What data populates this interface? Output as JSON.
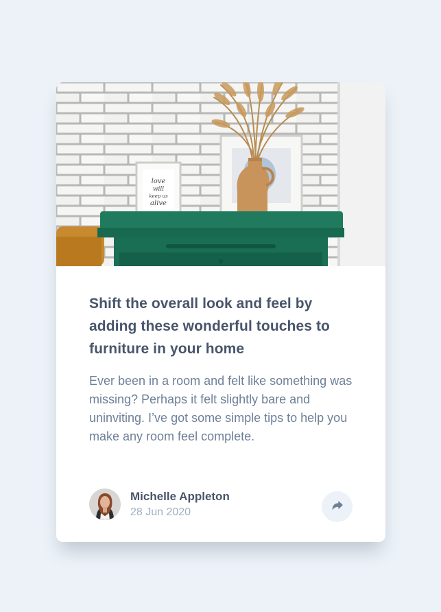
{
  "article": {
    "title": "Shift the overall look and feel by adding these wonderful touches to furniture in your home",
    "description": "Ever been in a room and felt like something was missing? Perhaps it felt slightly bare and uninviting. I’ve got some simple tips to help you make any room feel complete."
  },
  "author": {
    "name": "Michelle Appleton",
    "date": "28 Jun 2020"
  },
  "hero_frame_text": "love will keep us alive",
  "icons": {
    "share": "share-icon"
  },
  "colors": {
    "page_background": "#ecf2f8",
    "card_background": "#ffffff",
    "title": "#48556a",
    "body_text": "#6e8098",
    "date": "#9eafc2",
    "share_button_bg": "#ecf2f8",
    "share_icon": "#6e8098"
  }
}
